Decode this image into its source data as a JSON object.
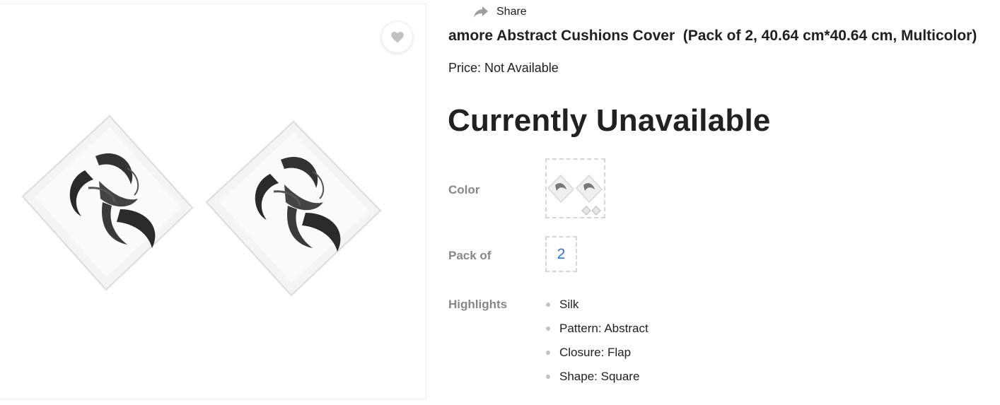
{
  "share": {
    "label": "Share",
    "icon": "share-arrow-icon"
  },
  "wishlist": {
    "icon": "heart-icon"
  },
  "product": {
    "title": "amore Abstract Cushions Cover  (Pack of 2, 40.64 cm*40.64 cm, Multicolor)",
    "price": "Price: Not Available",
    "availability": "Currently Unavailable"
  },
  "variants": {
    "color_label": "Color",
    "pack_label": "Pack of",
    "pack_value": "2"
  },
  "highlights": {
    "label": "Highlights",
    "items": [
      "Silk",
      "Pattern: Abstract",
      "Closure: Flap",
      "Shape: Square"
    ]
  },
  "colors": {
    "text": "#212121",
    "muted": "#878787",
    "accent": "#2874f0",
    "border": "#f0f0f0"
  }
}
